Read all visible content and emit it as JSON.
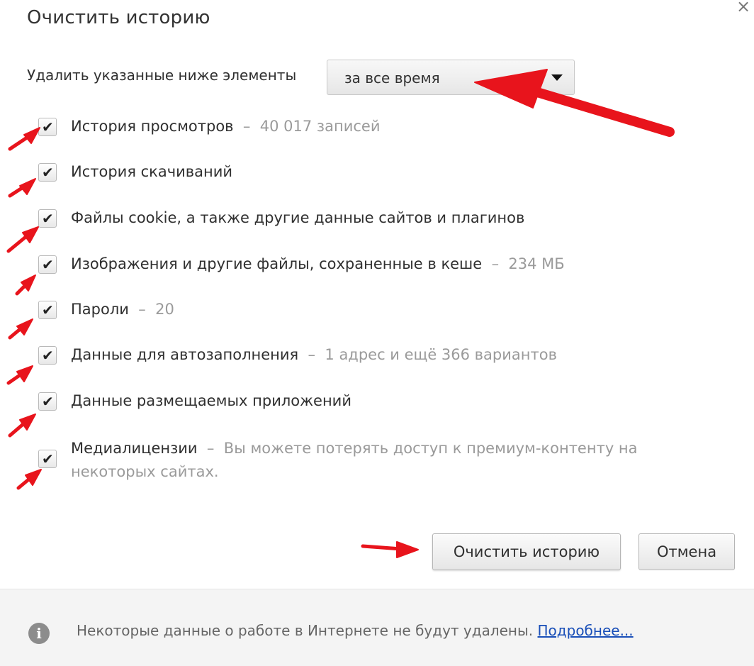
{
  "dialog": {
    "title": "Очистить историю",
    "close_glyph": "×"
  },
  "range": {
    "label": "Удалить указанные ниже элементы",
    "selected": "за все время"
  },
  "options": [
    {
      "label": "История просмотров",
      "sep": "–",
      "detail": "40 017 записей",
      "checked": true
    },
    {
      "label": "История скачиваний",
      "sep": "",
      "detail": "",
      "checked": true
    },
    {
      "label": "Файлы cookie, а также другие данные сайтов и плагинов",
      "sep": "",
      "detail": "",
      "checked": true
    },
    {
      "label": "Изображения и другие файлы, сохраненные в кеше",
      "sep": "–",
      "detail": "234 МБ",
      "checked": true
    },
    {
      "label": "Пароли",
      "sep": "–",
      "detail": "20",
      "checked": true
    },
    {
      "label": "Данные для автозаполнения",
      "sep": "–",
      "detail": "1 адрес и ещё 366 вариантов",
      "checked": true
    },
    {
      "label": "Данные размещаемых приложений",
      "sep": "",
      "detail": "",
      "checked": true
    },
    {
      "label": "Медиалицензии",
      "sep": "–",
      "detail": "Вы можете потерять доступ к премиум-контенту на некоторых сайтах.",
      "checked": true
    }
  ],
  "buttons": {
    "clear": "Очистить историю",
    "cancel": "Отмена"
  },
  "footer": {
    "text": "Некоторые данные о работе в Интернете не будут удалены.",
    "link": "Подробнее..."
  },
  "icons": {
    "checkbox_tick": "✔",
    "info": "i"
  },
  "annotation_color": "#e8141c"
}
